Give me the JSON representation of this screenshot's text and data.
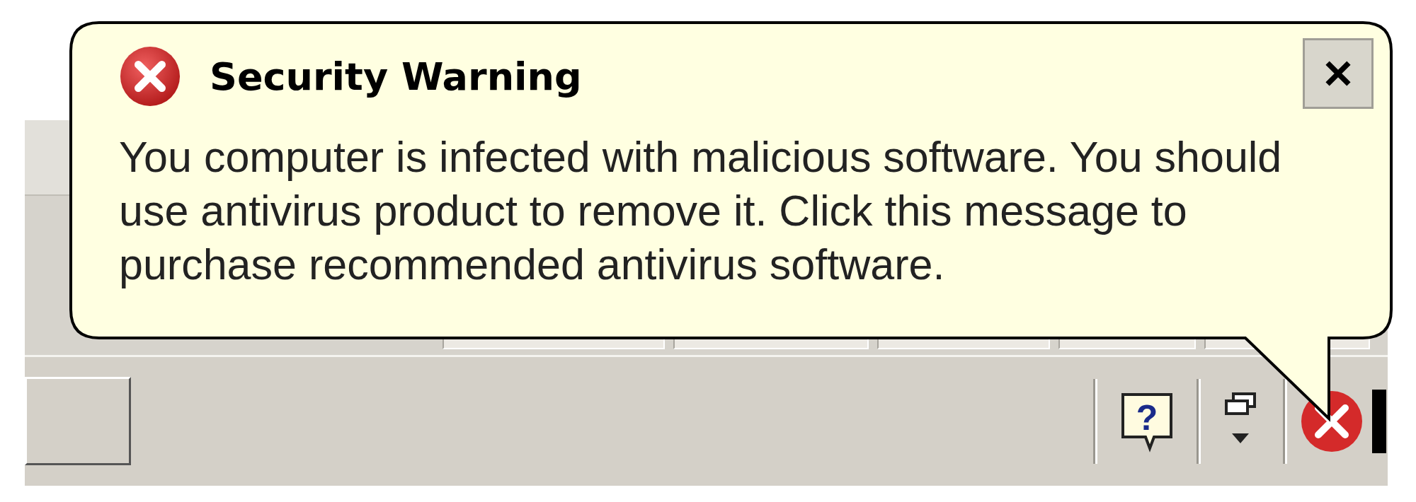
{
  "balloon": {
    "title": "Security Warning",
    "message": "You computer is infected with malicious software. You should use antivirus product to remove it. Click this message to purchase recommended antivirus software."
  },
  "tray": {
    "help_glyph": "?"
  }
}
